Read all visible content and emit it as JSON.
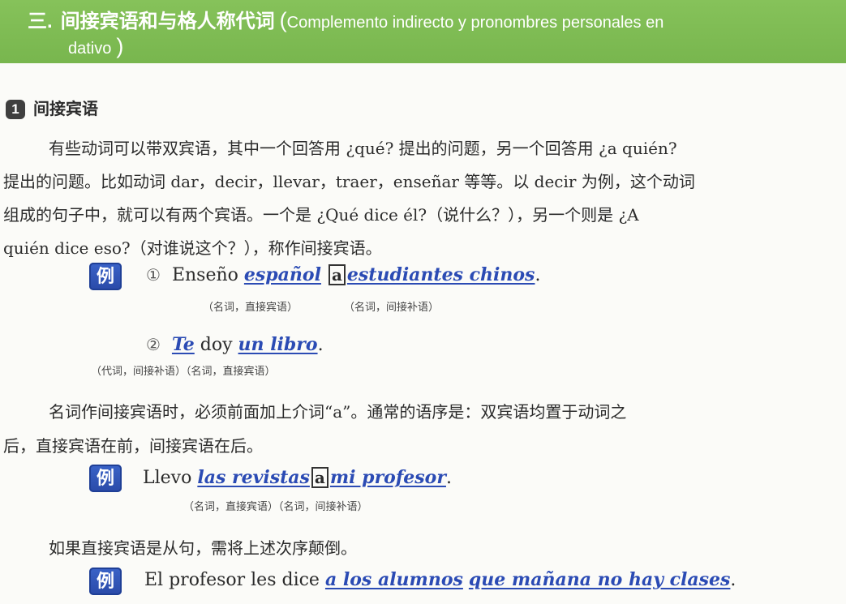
{
  "header": {
    "number": "三.",
    "title_zh": "间接宾语和与格人称代词",
    "open_paren": "(",
    "title_es_line1": "Complemento indirecto y pronombres personales en",
    "title_es_line2": "dativo",
    "close_paren": ")"
  },
  "section1": {
    "badge": "1",
    "title": "间接宾语",
    "para1": [
      "有些动词可以带双宾语，其中一个回答用 ¿qué? 提出的问题，另一个回答用 ¿a quién?",
      "提出的问题。比如动词 dar，decir，llevar，traer，enseñar 等等。以 decir 为例，这个动词",
      "组成的句子中，就可以有两个宾语。一个是 ¿Qué dice él?（说什么？），另一个则是 ¿A",
      "quién dice eso?（对谁说这个？），称作间接宾语。"
    ],
    "example_icon": "例",
    "ex1": {
      "num": "①",
      "pre": "Enseño",
      "direct": "español",
      "prep": "a",
      "indirect": "estudiantes chinos",
      "end": ".",
      "ann1": "（名词，直接宾语）",
      "ann2": "（名词，间接补语）"
    },
    "ex2": {
      "num": "②",
      "pron": "Te",
      "verb": "doy",
      "obj": "un libro",
      "end": ".",
      "ann": "（代词，间接补语）（名词，直接宾语）"
    },
    "para2": [
      "名词作间接宾语时，必须前面加上介词“a”。通常的语序是：双宾语均置于动词之",
      "后，直接宾语在前，间接宾语在后。"
    ],
    "ex3": {
      "pre": "Llevo",
      "direct": "las revistas",
      "prep": "a",
      "indirect": "mi profesor",
      "end": ".",
      "ann": "（名词，直接宾语）（名词，间接补语）"
    },
    "para3": "如果直接宾语是从句，需将上述次序颠倒。",
    "ex4": {
      "pre": "El profesor les dice",
      "indirect": "a los alumnos",
      "clause": "que mañana no hay clases",
      "end": "."
    }
  },
  "colors": {
    "header_green": "#7cba51",
    "example_blue": "#2b4bb4"
  }
}
